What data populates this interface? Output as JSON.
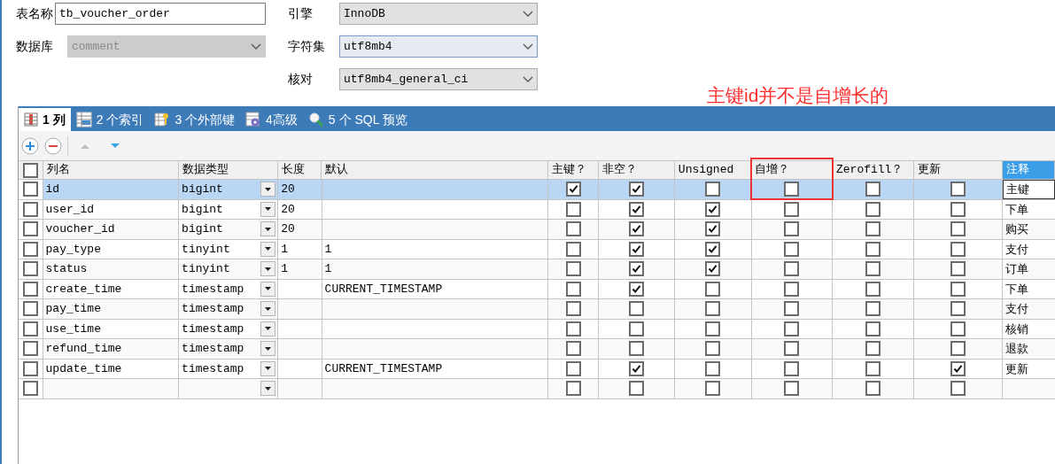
{
  "form": {
    "table_name": {
      "label": "表名称",
      "value": "tb_voucher_order"
    },
    "database": {
      "label": "数据库",
      "value": "comment",
      "disabled": true
    },
    "engine": {
      "label": "引擎",
      "value": "InnoDB"
    },
    "charset": {
      "label": "字符集",
      "value": "utf8mb4"
    },
    "collation": {
      "label": "核对",
      "value": "utf8mb4_general_ci"
    }
  },
  "tabs": [
    {
      "label": "1 列",
      "selected": true,
      "kind": "columns"
    },
    {
      "label": "2 个索引",
      "selected": false,
      "kind": "indexes"
    },
    {
      "label": "3 个外部键",
      "selected": false,
      "kind": "foreign"
    },
    {
      "label": "4高级",
      "selected": false,
      "kind": "advanced"
    },
    {
      "label": "5 个 SQL 预览",
      "selected": false,
      "kind": "sql"
    }
  ],
  "annotation": "主键id并不是自增长的",
  "table": {
    "columns": [
      "列名",
      "数据类型",
      "长度",
      "默认",
      "主键？",
      "非空？",
      "Unsigned",
      "自增？",
      "Zerofill？",
      "更新",
      "注释"
    ],
    "header_checked": false,
    "rows": [
      {
        "checked": false,
        "selected": true,
        "name": "id",
        "type": "bigint",
        "length": "20",
        "default": "",
        "primary_key": true,
        "not_null": true,
        "unsigned": false,
        "auto_increment": false,
        "zerofill": false,
        "on_update": false,
        "comment": "主键"
      },
      {
        "checked": false,
        "selected": false,
        "name": "user_id",
        "type": "bigint",
        "length": "20",
        "default": "",
        "primary_key": false,
        "not_null": true,
        "unsigned": true,
        "auto_increment": false,
        "zerofill": false,
        "on_update": false,
        "comment": "下单"
      },
      {
        "checked": false,
        "selected": false,
        "name": "voucher_id",
        "type": "bigint",
        "length": "20",
        "default": "",
        "primary_key": false,
        "not_null": true,
        "unsigned": true,
        "auto_increment": false,
        "zerofill": false,
        "on_update": false,
        "comment": "购买"
      },
      {
        "checked": false,
        "selected": false,
        "name": "pay_type",
        "type": "tinyint",
        "length": "1",
        "default": "1",
        "primary_key": false,
        "not_null": true,
        "unsigned": true,
        "auto_increment": false,
        "zerofill": false,
        "on_update": false,
        "comment": "支付"
      },
      {
        "checked": false,
        "selected": false,
        "name": "status",
        "type": "tinyint",
        "length": "1",
        "default": "1",
        "primary_key": false,
        "not_null": true,
        "unsigned": true,
        "auto_increment": false,
        "zerofill": false,
        "on_update": false,
        "comment": "订单"
      },
      {
        "checked": false,
        "selected": false,
        "name": "create_time",
        "type": "timestamp",
        "length": "",
        "default": "CURRENT_TIMESTAMP",
        "primary_key": false,
        "not_null": true,
        "unsigned": false,
        "auto_increment": false,
        "zerofill": false,
        "on_update": false,
        "comment": "下单"
      },
      {
        "checked": false,
        "selected": false,
        "name": "pay_time",
        "type": "timestamp",
        "length": "",
        "default": "",
        "primary_key": false,
        "not_null": false,
        "unsigned": false,
        "auto_increment": false,
        "zerofill": false,
        "on_update": false,
        "comment": "支付"
      },
      {
        "checked": false,
        "selected": false,
        "name": "use_time",
        "type": "timestamp",
        "length": "",
        "default": "",
        "primary_key": false,
        "not_null": false,
        "unsigned": false,
        "auto_increment": false,
        "zerofill": false,
        "on_update": false,
        "comment": "核销"
      },
      {
        "checked": false,
        "selected": false,
        "name": "refund_time",
        "type": "timestamp",
        "length": "",
        "default": "",
        "primary_key": false,
        "not_null": false,
        "unsigned": false,
        "auto_increment": false,
        "zerofill": false,
        "on_update": false,
        "comment": "退款"
      },
      {
        "checked": false,
        "selected": false,
        "name": "update_time",
        "type": "timestamp",
        "length": "",
        "default": "CURRENT_TIMESTAMP",
        "primary_key": false,
        "not_null": true,
        "unsigned": false,
        "auto_increment": false,
        "zerofill": false,
        "on_update": true,
        "comment": "更新"
      },
      {
        "checked": false,
        "selected": false,
        "name": "",
        "type": "",
        "length": "",
        "default": "",
        "primary_key": false,
        "not_null": false,
        "unsigned": false,
        "auto_increment": false,
        "zerofill": false,
        "on_update": false,
        "comment": ""
      }
    ]
  }
}
